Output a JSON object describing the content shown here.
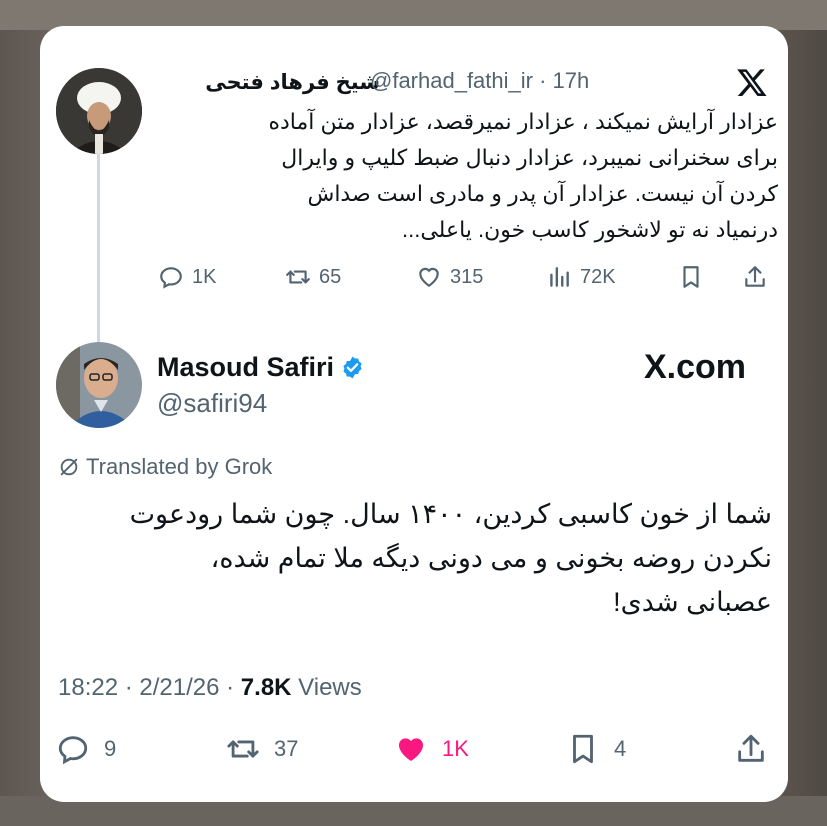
{
  "quoted": {
    "name": "شیخ فرهاد فتحی",
    "handle": "@farhad_fathi_ir · 17h",
    "body_lines": [
      "عزادار آرایش نمیکند ، عزادار نمیرقصد، عزادار متن آماده",
      "برای سخنرانی نمیبرد، عزادار دنبال ضبط کلیپ و وایرال",
      "کردن آن نیست. عزادار آن پدر و مادری است صداش",
      "درنمیاد نه تو لاشخور کاسب خون. یاعلی..."
    ],
    "replies": "1K",
    "reposts": "65",
    "likes": "315",
    "views": "72K"
  },
  "main": {
    "name": "Masoud Safiri",
    "handle": "@safiri94",
    "watermark": "X.com",
    "translated_label": "Translated by Grok",
    "body_lines": [
      "شما از خون کاسبی کردین، ۱۴۰۰ سال. چون شما رودعوت",
      "نکردن روضه بخونی و می دونی دیگه ملا تمام شده،",
      "عصبانی شدی!"
    ],
    "time": "18:22 · 2/21/26 · ",
    "views_count": "7.8K",
    "views_label": " Views",
    "replies": "9",
    "reposts": "37",
    "likes": "1K",
    "bookmarks": "4"
  },
  "colors": {
    "text": "#0f1419",
    "muted": "#536471",
    "like": "#f91880",
    "verified": "#1d9bf0"
  },
  "icons": [
    "x-logo-icon",
    "reply-icon",
    "repost-icon",
    "like-icon",
    "views-icon",
    "bookmark-icon",
    "share-icon",
    "verified-badge-icon",
    "grok-translate-icon"
  ]
}
